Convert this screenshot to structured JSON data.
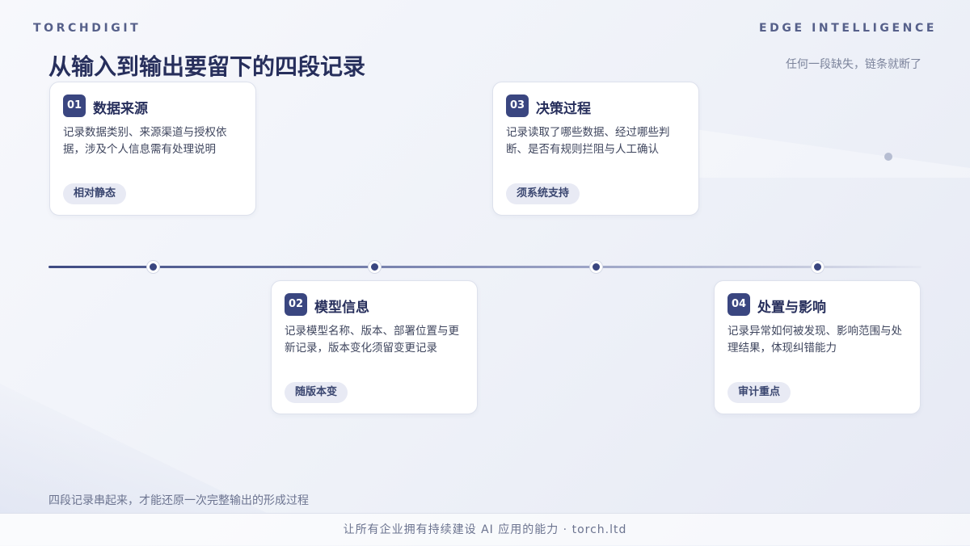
{
  "header": {
    "brand": "TORCHDIGIT",
    "tagline": "EDGE INTELLIGENCE",
    "title": "从输入到输出要留下的四段记录",
    "subtitle": "任何一段缺失，链条就断了"
  },
  "cards": [
    {
      "num": "01",
      "title": "数据来源",
      "desc": "记录数据类别、来源渠道与授权依据，涉及个人信息需有处理说明",
      "tag": "相对静态"
    },
    {
      "num": "02",
      "title": "模型信息",
      "desc": "记录模型名称、版本、部署位置与更新记录，版本变化须留变更记录",
      "tag": "随版本变"
    },
    {
      "num": "03",
      "title": "决策过程",
      "desc": "记录读取了哪些数据、经过哪些判断、是否有规则拦阻与人工确认",
      "tag": "须系统支持"
    },
    {
      "num": "04",
      "title": "处置与影响",
      "desc": "记录异常如何被发现、影响范围与处理结果，体现纠错能力",
      "tag": "审计重点"
    }
  ],
  "footnote": "四段记录串起来，才能还原一次完整输出的形成过程",
  "footer": "让所有企业拥有持续建设 AI 应用的能力  ·  torch.ltd",
  "colors": {
    "accent": "#3a4680",
    "title": "#272f5c",
    "pill_bg": "#e8eaf4"
  }
}
